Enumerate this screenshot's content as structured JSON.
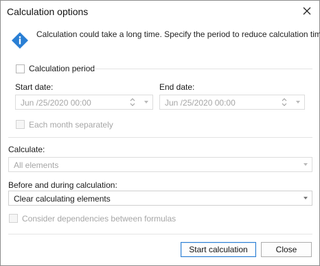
{
  "dialog": {
    "title": "Calculation options",
    "close_icon": "close-icon"
  },
  "info": {
    "icon": "info-diamond-icon",
    "text": "Calculation could take a long time. Specify the period to reduce calculation time.",
    "color": "#2a7fd4"
  },
  "period": {
    "checkbox_label": "Calculation period",
    "checked": false,
    "start_label": "Start date:",
    "start_value": "Jun /25/2020 00:00",
    "end_label": "End date:",
    "end_value": "Jun /25/2020 00:00",
    "each_month_label": "Each month separately"
  },
  "calculate": {
    "label": "Calculate:",
    "value": "All elements"
  },
  "before_during": {
    "label": "Before and during calculation:",
    "value": "Clear calculating elements"
  },
  "dependencies": {
    "label": "Consider dependencies between formulas"
  },
  "buttons": {
    "start": "Start calculation",
    "close": "Close"
  },
  "colors": {
    "accent": "#2d7fd3",
    "disabled_text": "#a6a6a6"
  }
}
